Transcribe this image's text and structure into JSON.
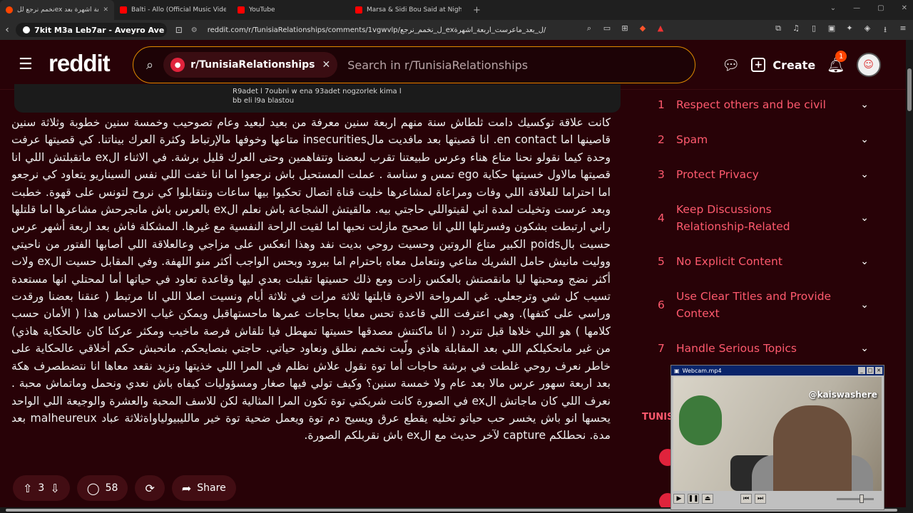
{
  "browser": {
    "tabs": [
      {
        "title": "نخمم نرجع للex اربعة اشهرة بعد",
        "favicon": "reddit",
        "active": true
      },
      {
        "title": "Balti - Allo (Official Music Video) - Yo",
        "favicon": "youtube",
        "active": false
      },
      {
        "title": "YouTube",
        "favicon": "youtube",
        "active": false
      },
      {
        "title": "Marsa & Sidi Bou Said at Night 🌙 |",
        "favicon": "youtube",
        "active": false
      }
    ],
    "site_title": "7kit M3a Leb7ar - Aveyro Ave",
    "url": "reddit.com/r/TunisiaRelationships/comments/1vgwvlp/ل_نخمم_نرجع_exل_بعد_ماعرست_اربعة_اشهرة/"
  },
  "header": {
    "logo": "reddit",
    "community_chip": "r/TunisiaRelationships",
    "search_placeholder": "Search in r/TunisiaRelationships",
    "create_label": "Create",
    "notification_count": "1"
  },
  "image_caption": "R9adet l 7oubni w ena 93adet nogzorlek kima l bb eli l9a blastou",
  "post": {
    "body": "كانت علاقة توكسيك دامت ثلطاش سنة منهم اربعة سنين معرفة من بعيد لبعيد وعام تصوحيب وخمسة سنين خطوبة وثلاثة سنين قاصينها اما en contact. انا قصيتها بعد مافديت مالinsecurities متاعها وخوفها مالإرتباط وكثرة العرك بيناتنا. كي قصيتها عرفت وحدة كيما نقولو نحنا متاع هناء وعرس طبيعتنا تقرب لبعضنا وتتفاهمين وحتى العرك قليل برشة. في الاثناء الex ماتقبلتش اللي انا قصيتها مالاول خسيتها حكاية ego تمس و سناسة . عملت المستحيل باش نرجعوا اما انا خفت اللي نفس السيناريو يتعاود كي نرجعو اما احتراما للعلاقة اللي وفات ومراعاة لمشاعرها خليت قناة اتصال تحكيوا بيها ساعات ونتقابلوا كي نروح لتونس على قهوة. خطبت وبعد عرست وتخيلت لمدة اني لقيتواللي حاجتي بيه. مالقيتش الشجاعة باش نعلم الex بالعرس باش مانجرحش مشاعرها اما قلتلها راني ارتبطت بشكون وفسرتلها اللي انا صحيح مازلت نحبها اما لقيت الراحة النفسية مع غيرها. المشكلة فاش بعد اربعة أشهر عرس حسيت بالpoids الكبير متاع الروتين وحسيت روحي بديت نفد وهذا انعكس على مزاجي وعالعلاقة اللي أصابها الفتور من ناحيتي ووليت مانيش حامل الشريك متاعي ونتعامل معاه باحترام اما ببرود وبحس الواجب أكثر منو اللهفة. وفي المقابل حسيت الex ولات أكثر نضج ومحبتها ليا مانقصتش بالعكس زادت ومع ذلك حسيتها تقبلت بعدي ليها وقاعدة تعاود في حياتها أما لمحتلي انها مستعدة تسيب كل شي وترجعلي. غي المرواحة الاخرة قابلتها ثلاثة مرات في ثلاثة أيام ونسيت اصلا اللي انا مرتبط ( عنقنا بعضنا ورقدت وراسي على كتفها). وهي اعترفت اللي قاعدة تحس معايا بحاجات عمرها ماحستهاقبل ويمكن غياب الاحساس هذا ( الأمان حسب كلامها ) هو اللي خلاها قبل تتردد ( انا ماكنتش مصدقها حسيتها تمهطل فيا تلقاش فرصة ماخيب ومكثر عركنا كان عالحكاية هاذي) من غير مانحكيلكم اللي بعد المقابلة هاذي ولّيت نخمم نطلق ونعاود حياتي. حاجتي بنصايحكم. مانحبش حكم أخلاقي عالحكاية على خاطر نعرف روحي غلطت في برشة حاجات أما توة نقول علاش نظلم في المرا اللي خذيتها ونزيد نقعد معاها انا نتضطصرف هكة بعد اربعة سهور عرس مالا بعد عام ولا خمسة سنين؟ وكيف تولي فيها صغار ومسؤوليات كيفاه باش نعدي ونحمل وماتماش محبة . نعرف اللي كان ماجاتش الex في الصورة كانت شريكتي توة تكون المرا المثالية لكن للاسف المحبة والعشرة والوجيعة اللي الواحد يحسها انو باش يخسر حب حياتو تخليه يقطع عرق ويسيح دم توة ويعمل ضحية توة خير مالليبيولياواةثلاثة عباد malheureux بعد مدة. نحطلكم capture لآخر حديث مع الex باش نقربلكم الصورة.",
    "votes": "3",
    "comments": "58",
    "share_label": "Share"
  },
  "rules": [
    {
      "num": "1",
      "text": "Respect others and be civil"
    },
    {
      "num": "2",
      "text": "Spam"
    },
    {
      "num": "3",
      "text": "Protect Privacy"
    },
    {
      "num": "4",
      "text": "Keep Discussions Relationship-Related"
    },
    {
      "num": "5",
      "text": "No Explicit Content"
    },
    {
      "num": "6",
      "text": "Use Clear Titles and Provide Context"
    },
    {
      "num": "7",
      "text": "Handle Serious Topics"
    }
  ],
  "sidebar_heading_partial": "TUNIS",
  "webcam": {
    "title": "Webcam.mp4",
    "handle": "@kaiswashere"
  }
}
